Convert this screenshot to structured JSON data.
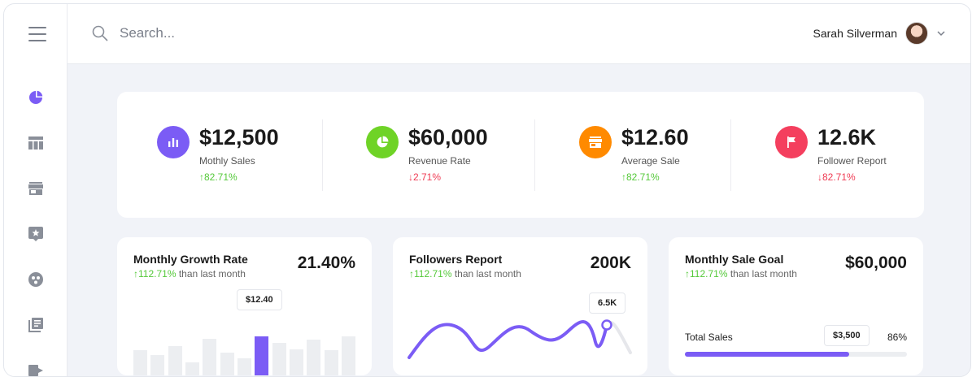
{
  "search": {
    "placeholder": "Search..."
  },
  "user": {
    "name": "Sarah Silverman"
  },
  "sidebar": {
    "items": [
      {
        "name": "dashboard",
        "icon": "pie-chart-icon",
        "active": true
      },
      {
        "name": "table",
        "icon": "table-icon"
      },
      {
        "name": "store",
        "icon": "store-icon"
      },
      {
        "name": "feedback",
        "icon": "star-message-icon"
      },
      {
        "name": "groups",
        "icon": "dots-circle-icon"
      },
      {
        "name": "library",
        "icon": "library-icon"
      }
    ]
  },
  "stats": [
    {
      "value": "$12,500",
      "label": "Mothly Sales",
      "change": "82.71%",
      "direction": "up",
      "icon": "bar-chart-icon",
      "color": "#7b5cf5"
    },
    {
      "value": "$60,000",
      "label": "Revenue Rate",
      "change": "2.71%",
      "direction": "down",
      "icon": "pie-chart-icon",
      "color": "#6fd327"
    },
    {
      "value": "$12.60",
      "label": "Average Sale",
      "change": "82.71%",
      "direction": "up",
      "icon": "store-icon",
      "color": "#ff8a00"
    },
    {
      "value": "12.6K",
      "label": "Follower Report",
      "change": "82.71%",
      "direction": "down",
      "icon": "flag-icon",
      "color": "#f43f5e"
    }
  ],
  "cards": {
    "growth": {
      "title": "Monthly Growth Rate",
      "change": "112.71%",
      "suffix": "than last month",
      "value": "21.40%",
      "tooltip": "$12.40",
      "bars": [
        0.55,
        0.45,
        0.65,
        0.28,
        0.8,
        0.5,
        0.38,
        0.85,
        0.72,
        0.58,
        0.78,
        0.55,
        0.85
      ],
      "active_index": 7
    },
    "followers": {
      "title": "Followers Report",
      "change": "112.71%",
      "suffix": "than last month",
      "value": "200K",
      "tooltip": "6.5K"
    },
    "sale_goal": {
      "title": "Monthly Sale Goal",
      "change": "112.71%",
      "suffix": "than last month",
      "value": "$60,000",
      "total_label": "Total Sales",
      "tooltip": "$3,500",
      "percent_text": "86%",
      "progress": 0.74
    }
  },
  "colors": {
    "accent": "#7b5cf5",
    "up": "#55c93a",
    "down": "#ef3b53"
  }
}
